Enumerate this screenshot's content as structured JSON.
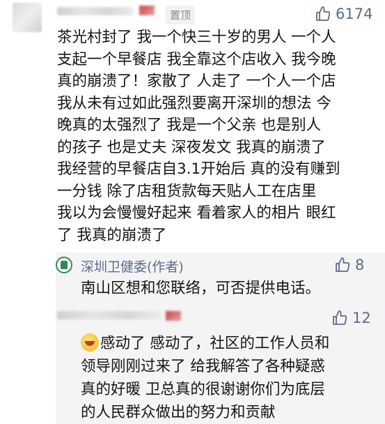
{
  "comment1": {
    "pinned_label": "置顶",
    "likes": "6174",
    "lines": [
      "茶光村封了 我一个快三十岁的男人 一个人",
      "支起一个早餐店 我全靠这个店收入 我今晚",
      "真的崩溃了！家散了 人走了 一个人一个店",
      "我从未有过如此强烈要离开深圳的想法 今",
      "晚真的太强烈了 我是一个父亲  也是别人",
      "的孩子 也是丈夫  深夜发文 我真的崩溃了",
      "我经营的早餐店自3.1开始后 真的没有赚到",
      "一分钱 除了店租货款每天贴人工在店里",
      "我以为会慢慢好起来 看着家人的相片 眼红",
      "了 我真的崩溃了"
    ]
  },
  "author_reply": {
    "name": "深圳卫健委(作者)",
    "likes": "8",
    "text": "南山区想和您联络，可否提供电话。"
  },
  "comment2": {
    "likes": "12",
    "lines": [
      "感动了 感动了，社区的工作人员和",
      "领导刚刚过来了 给我解答了各种疑惑",
      "真的好暖 卫总真的很谢谢你们为底层",
      "的人民群众做出的努力和贡献"
    ]
  },
  "colors": {
    "link_blue": "#5b6b8c",
    "reply_bg": "#f4f4f4"
  }
}
